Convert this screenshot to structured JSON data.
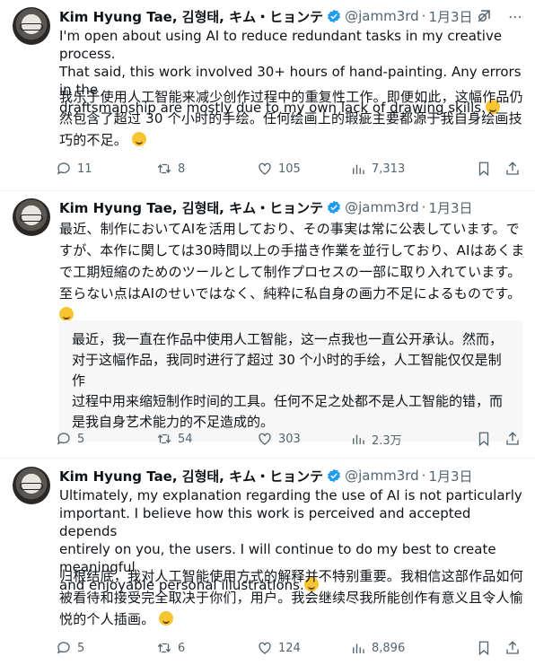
{
  "colors": {
    "text": "#0f1419",
    "secondary": "#536471",
    "verified": "#1d9bf0",
    "quote_bg": "#f7f7f7"
  },
  "tweets": [
    {
      "author": "Kim Hyung Tae, 김형태, キム・ヒョンテ",
      "handle": "@jamm3rd",
      "date": "1月3日",
      "text_lines": [
        "I'm open about using AI to reduce redundant tasks in my creative process.",
        "That said, this work involved 30+ hours of hand-painting. Any errors in the",
        "draftsmanship are mostly due to my own lack of drawing skills."
      ],
      "zh_lines": [
        "我乐于使用人工智能来减少创作过程中的重复性工作。即便如此，这幅作品仍",
        "然包含了超过 30 个小时的手绘。任何绘画上的瑕疵主要都源于我自身绘画技",
        "巧的不足。"
      ],
      "replies": "11",
      "reposts": "8",
      "likes": "105",
      "views": "7,313"
    },
    {
      "author": "Kim Hyung Tae, 김형태, キム・ヒョンテ",
      "handle": "@jamm3rd",
      "date": "1月3日",
      "text_lines": [
        "最近、制作においてAIを活用しており、その事実は常に公表しています。で",
        "すが、本作に関しては30時間以上の手描き作業を並行しており、AIはあくま",
        "で工期短縮のためのツールとして制作プロセスの一部に取り入れています。",
        "至らない点はAIのせいではなく、純粋に私自身の画力不足によるものです。"
      ],
      "quote_lines": [
        "最近，我一直在作品中使用人工智能，这一点我也一直公开承认。然而，",
        "对于这幅作品，我同时进行了超过 30 个小时的手绘，人工智能仅仅是制作",
        "过程中用来缩短制作时间的工具。任何不足之处都不是人工智能的错，而",
        "是我自身艺术能力的不足造成的。"
      ],
      "replies": "5",
      "reposts": "54",
      "likes": "303",
      "views": "2.3万"
    },
    {
      "author": "Kim Hyung Tae, 김형태, キム・ヒョンテ",
      "handle": "@jamm3rd",
      "date": "1月3日",
      "text_lines": [
        "Ultimately, my explanation regarding the use of AI is not particularly",
        "important. I believe how this work is perceived and accepted depends",
        "entirely on you, the users. I will continue to do my best to create meaningful",
        "and enjoyable personal illustrations."
      ],
      "zh_lines": [
        "归根结底，我对人工智能使用方式的解释并不特别重要。我相信这部作品如何",
        "被看待和接受完全取决于你们，用户。我会继续尽我所能创作有意义且令人愉",
        "悦的个人插画。"
      ],
      "replies": "5",
      "reposts": "6",
      "likes": "124",
      "views": "8,896"
    }
  ]
}
